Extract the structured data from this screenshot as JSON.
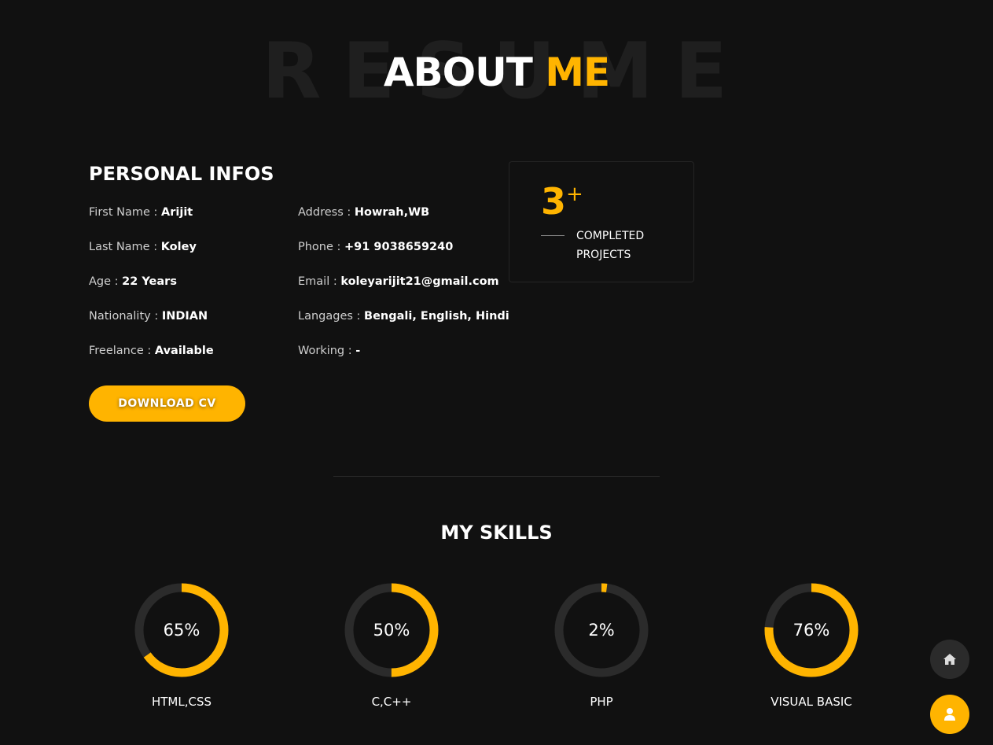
{
  "header": {
    "background_word": "RESUME",
    "title_part1": "ABOUT",
    "title_part2": "ME"
  },
  "personal_infos": {
    "heading": "PERSONAL INFOS",
    "left": [
      {
        "key": "First Name",
        "value": "Arijit"
      },
      {
        "key": "Last Name",
        "value": "Koley"
      },
      {
        "key": "Age",
        "value": "22 Years"
      },
      {
        "key": "Nationality",
        "value": "INDIAN"
      },
      {
        "key": "Freelance",
        "value": "Available"
      }
    ],
    "right": [
      {
        "key": "Address",
        "value": "Howrah,WB"
      },
      {
        "key": "Phone",
        "value": "+91 9038659240"
      },
      {
        "key": "Email",
        "value": "koleyarijit21@gmail.com"
      },
      {
        "key": "Langages",
        "value": "Bengali, English, Hindi"
      },
      {
        "key": "Working",
        "value": "-"
      }
    ],
    "separator": " : ",
    "download_label": "DOWNLOAD CV"
  },
  "stats": {
    "number": "3",
    "plus": "+",
    "label": "COMPLETED PROJECTS"
  },
  "skills": {
    "heading": "MY SKILLS",
    "items": [
      {
        "name": "HTML,CSS",
        "percent": 65,
        "percent_label": "65%"
      },
      {
        "name": "C,C++",
        "percent": 50,
        "percent_label": "50%"
      },
      {
        "name": "PHP",
        "percent": 2,
        "percent_label": "2%"
      },
      {
        "name": "VISUAL BASIC",
        "percent": 76,
        "percent_label": "76%"
      }
    ]
  },
  "colors": {
    "accent": "#ffb400",
    "background": "#111111",
    "ring_track": "#2b2b2b"
  },
  "floating_buttons": [
    {
      "icon": "home-icon"
    },
    {
      "icon": "user-icon"
    }
  ]
}
